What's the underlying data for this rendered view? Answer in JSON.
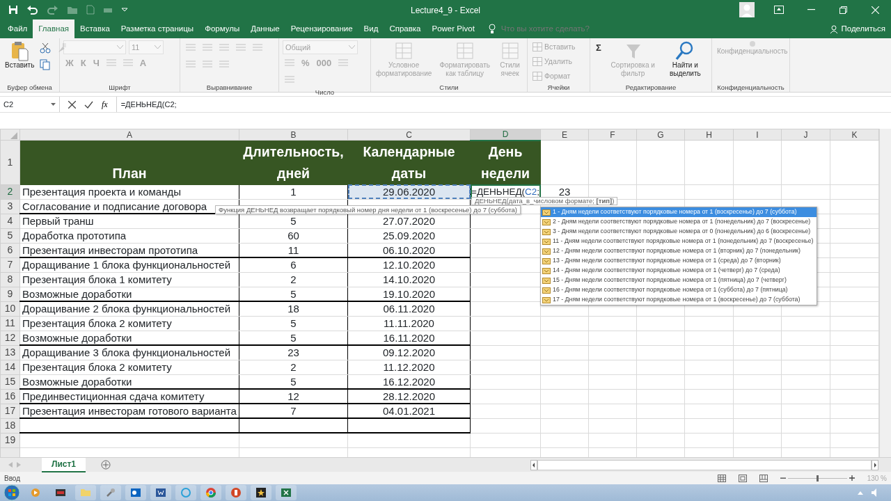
{
  "window": {
    "title": "Lecture4_9  -  Excel"
  },
  "menu_tabs": [
    {
      "label": "Файл",
      "selected": false
    },
    {
      "label": "Главная",
      "selected": true
    },
    {
      "label": "Вставка",
      "selected": false
    },
    {
      "label": "Разметка страницы",
      "selected": false
    },
    {
      "label": "Формулы",
      "selected": false
    },
    {
      "label": "Данные",
      "selected": false
    },
    {
      "label": "Рецензирование",
      "selected": false
    },
    {
      "label": "Вид",
      "selected": false
    },
    {
      "label": "Справка",
      "selected": false
    },
    {
      "label": "Power Pivot",
      "selected": false
    }
  ],
  "tell_me": {
    "placeholder": "Что вы хотите сделать?"
  },
  "share": {
    "label": "Поделиться"
  },
  "ribbon": {
    "groups": [
      {
        "label": "Буфер обмена",
        "items": [
          {
            "kind": "large",
            "label": "Вставить",
            "disabled": false
          },
          {
            "kind": "icon",
            "disabled": false
          },
          {
            "kind": "icon",
            "disabled": false
          },
          {
            "kind": "icon",
            "disabled": true
          }
        ]
      },
      {
        "label": "Шрифт",
        "items": [
          {
            "kind": "fontbox",
            "disabled": true
          },
          {
            "kind": "combo",
            "value": "11",
            "disabled": true
          },
          {
            "kind": "glyph",
            "label": "Ж",
            "disabled": true
          },
          {
            "kind": "glyph",
            "label": "К",
            "disabled": true
          },
          {
            "kind": "glyph",
            "label": "Ч",
            "disabled": true
          },
          {
            "kind": "icon",
            "disabled": true
          },
          {
            "kind": "icon",
            "disabled": true
          },
          {
            "kind": "glyph",
            "label": "A",
            "disabled": true
          }
        ]
      },
      {
        "label": "Выравнивание",
        "items": [
          {
            "kind": "icon",
            "disabled": true
          },
          {
            "kind": "icon",
            "disabled": true
          },
          {
            "kind": "icon",
            "disabled": true
          },
          {
            "kind": "icon",
            "disabled": true
          },
          {
            "kind": "icon",
            "disabled": true
          },
          {
            "kind": "icon",
            "disabled": true
          },
          {
            "kind": "icon",
            "disabled": true
          },
          {
            "kind": "icon",
            "disabled": true
          }
        ]
      },
      {
        "label": "Число",
        "items": [
          {
            "kind": "combo",
            "value": "Общий",
            "disabled": true
          },
          {
            "kind": "icon",
            "disabled": true
          },
          {
            "kind": "glyph",
            "label": "%",
            "disabled": true
          },
          {
            "kind": "glyph",
            "label": "000",
            "disabled": true
          },
          {
            "kind": "icon",
            "disabled": true
          },
          {
            "kind": "icon",
            "disabled": true
          }
        ]
      },
      {
        "label": "Стили",
        "items": [
          {
            "kind": "large",
            "label": "Условное форматирование",
            "disabled": true
          },
          {
            "kind": "large",
            "label": "Форматировать как таблицу",
            "disabled": true
          },
          {
            "kind": "large",
            "label": "Стили ячеек",
            "disabled": true
          }
        ]
      },
      {
        "label": "Ячейки",
        "items": [
          {
            "kind": "small",
            "label": "Вставить",
            "disabled": true
          },
          {
            "kind": "small",
            "label": "Удалить",
            "disabled": true
          },
          {
            "kind": "small",
            "label": "Формат",
            "disabled": true
          }
        ]
      },
      {
        "label": "Редактирование",
        "items": [
          {
            "kind": "glyph",
            "label": "Σ",
            "disabled": false
          },
          {
            "kind": "large",
            "label": "Сортировка и фильтр",
            "disabled": true
          },
          {
            "kind": "large",
            "label": "Найти и выделить",
            "disabled": false
          }
        ]
      },
      {
        "label": "Конфиденциальность",
        "items": [
          {
            "kind": "large",
            "label": "Конфиденциальность",
            "disabled": true
          }
        ]
      }
    ]
  },
  "formula_bar": {
    "name_box": "C2",
    "function_button": "fx",
    "formula": "=ДЕНЬНЕД(C2;"
  },
  "columns": [
    {
      "label": "A",
      "selected": false
    },
    {
      "label": "B",
      "selected": false
    },
    {
      "label": "C",
      "selected": false
    },
    {
      "label": "D",
      "selected": true
    },
    {
      "label": "E",
      "selected": false
    },
    {
      "label": "F",
      "selected": false
    },
    {
      "label": "G",
      "selected": false
    },
    {
      "label": "H",
      "selected": false
    },
    {
      "label": "I",
      "selected": false
    },
    {
      "label": "J",
      "selected": false
    },
    {
      "label": "K",
      "selected": false
    }
  ],
  "header_row": {
    "num": "1",
    "cells": [
      "План",
      "Длительность, дней",
      "Календарные даты",
      "День недели"
    ]
  },
  "rows": [
    {
      "num": "2",
      "a": "Презентация проекта и команды",
      "b": "1",
      "c": "29.06.2020",
      "d": "=ДЕНЬНЕД(",
      "d_ref": "C2",
      "d_end": ";",
      "e": "23",
      "selected": true,
      "referenced": true,
      "rule_below": false
    },
    {
      "num": "3",
      "a": "Согласование и подписание договора",
      "selected": false,
      "referenced": false,
      "rule_below": true
    },
    {
      "num": "4",
      "a": "Первый транш",
      "b": "5",
      "c": "27.07.2020",
      "selected": false,
      "referenced": false,
      "rule_below": false
    },
    {
      "num": "5",
      "a": "Доработка прототипа",
      "b": "60",
      "c": "25.09.2020",
      "selected": false,
      "referenced": false,
      "rule_below": false
    },
    {
      "num": "6",
      "a": "Презентация инвесторам прототипа",
      "b": "11",
      "c": "06.10.2020",
      "selected": false,
      "referenced": false,
      "rule_below": true
    },
    {
      "num": "7",
      "a": "Доращивание 1 блока функциональностей",
      "b": "6",
      "c": "12.10.2020",
      "selected": false,
      "referenced": false,
      "rule_below": false
    },
    {
      "num": "8",
      "a": "Презентация блока 1 комитету",
      "b": "2",
      "c": "14.10.2020",
      "selected": false,
      "referenced": false,
      "rule_below": false
    },
    {
      "num": "9",
      "a": "Возможные доработки",
      "b": "5",
      "c": "19.10.2020",
      "selected": false,
      "referenced": false,
      "rule_below": true
    },
    {
      "num": "10",
      "a": "Доращивание 2 блока функциональностей",
      "b": "18",
      "c": "06.11.2020",
      "selected": false,
      "referenced": false,
      "rule_below": false
    },
    {
      "num": "11",
      "a": "Презентация блока 2 комитету",
      "b": "5",
      "c": "11.11.2020",
      "selected": false,
      "referenced": false,
      "rule_below": false
    },
    {
      "num": "12",
      "a": "Возможные доработки",
      "b": "5",
      "c": "16.11.2020",
      "selected": false,
      "referenced": false,
      "rule_below": true
    },
    {
      "num": "13",
      "a": "Доращивание 3 блока функциональностей",
      "b": "23",
      "c": "09.12.2020",
      "selected": false,
      "referenced": false,
      "rule_below": false
    },
    {
      "num": "14",
      "a": "Презентация блока 2 комитету",
      "b": "2",
      "c": "11.12.2020",
      "selected": false,
      "referenced": false,
      "rule_below": false
    },
    {
      "num": "15",
      "a": "Возможные доработки",
      "b": "5",
      "c": "16.12.2020",
      "selected": false,
      "referenced": false,
      "rule_below": true
    },
    {
      "num": "16",
      "a": "Прединвестиционная сдача комитету",
      "b": "12",
      "c": "28.12.2020",
      "selected": false,
      "referenced": false,
      "rule_below": true
    },
    {
      "num": "17",
      "a": "Презентация инвесторам готового варианта",
      "b": "7",
      "c": "04.01.2021",
      "selected": false,
      "referenced": false,
      "rule_below": true
    },
    {
      "num": "18",
      "selected": false,
      "referenced": false,
      "rule_below": true
    },
    {
      "num": "19",
      "selected": false,
      "referenced": false,
      "rule_below": false
    }
  ],
  "syntax_tip": "ДЕНЬНЕД(дата_в_числовом формате; **[тип]**)",
  "function_tip": "Функция ДЕНЬНЕД возвращает порядковый номер дня недели от 1 (воскресенье) до 7 (суббота)",
  "autocomplete": [
    {
      "label": "1 - Дням недели соответствуют порядковые номера от 1 (воскресенье) до 7 (суббота)",
      "selected": true
    },
    {
      "label": "2 - Дням недели соответствуют порядковые номера от 1 (понедельник) до 7 (воскресенье)",
      "selected": false
    },
    {
      "label": "3 - Дням недели соответствуют порядковые номера от 0 (понедельник) до 6 (воскресенье)",
      "selected": false
    },
    {
      "label": "11 - Дням недели соответствуют порядковые номера от 1 (понедельник) до 7 (воскресенье)",
      "selected": false
    },
    {
      "label": "12 - Дням недели соответствуют порядковые номера от 1 (вторник) до 7 (понедельник)",
      "selected": false
    },
    {
      "label": "13 - Дням недели соответствуют порядковые номера от 1 (среда) до 7 (вторник)",
      "selected": false
    },
    {
      "label": "14 - Дням недели соответствуют порядковые номера от 1 (четверг) до 7 (среда)",
      "selected": false
    },
    {
      "label": "15 - Дням недели соответствуют порядковые номера от 1 (пятница) до 7 (четверг)",
      "selected": false
    },
    {
      "label": "16 - Дням недели соответствуют порядковые номера от 1 (суббота) до 7 (пятница)",
      "selected": false
    },
    {
      "label": "17 - Дням недели соответствуют порядковые номера от 1 (воскресенье) до 7 (суббота)",
      "selected": false
    }
  ],
  "sheet_tabs": [
    {
      "label": "Лист1",
      "selected": true
    }
  ],
  "status_bar": {
    "mode": "Ввод",
    "zoom": {
      "level": 0.5,
      "reading": "130 %"
    }
  }
}
